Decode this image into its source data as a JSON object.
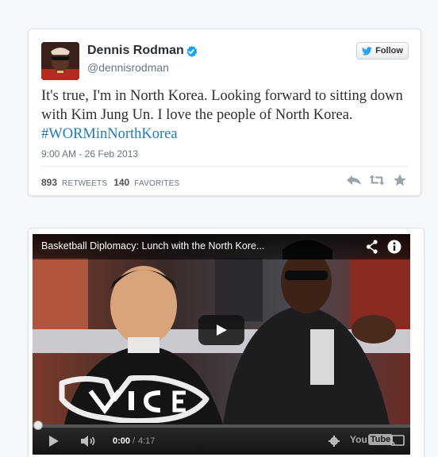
{
  "tweet": {
    "author": {
      "display_name": "Dennis Rodman",
      "handle": "@dennisrodman",
      "verified": true,
      "avatar_icon": "user-avatar"
    },
    "follow_label": "Follow",
    "text_plain": "It's true, I'm in North Korea.  Looking forward to sitting down with Kim Jung Un.  I love the people of North Korea. ",
    "hashtag": "#WORMinNorthKorea",
    "timestamp": "9:00 AM - 26 Feb 2013",
    "stats": {
      "retweets_count": "893",
      "retweets_label": "RETWEETS",
      "favorites_count": "140",
      "favorites_label": "FAVORITES"
    },
    "actions": [
      "reply-icon",
      "retweet-icon",
      "favorite-icon"
    ]
  },
  "video": {
    "title": "Basketball Diplomacy: Lunch with the North Kore...",
    "current_time": "0:00",
    "time_separator": "/",
    "duration": "4:17",
    "progress": 0,
    "brand": {
      "you": "You",
      "tube": "Tube"
    },
    "watermark": "VICE"
  },
  "colors": {
    "link": "#1e7bb5",
    "verified": "#1da1f2",
    "progress": "#cc181e"
  }
}
